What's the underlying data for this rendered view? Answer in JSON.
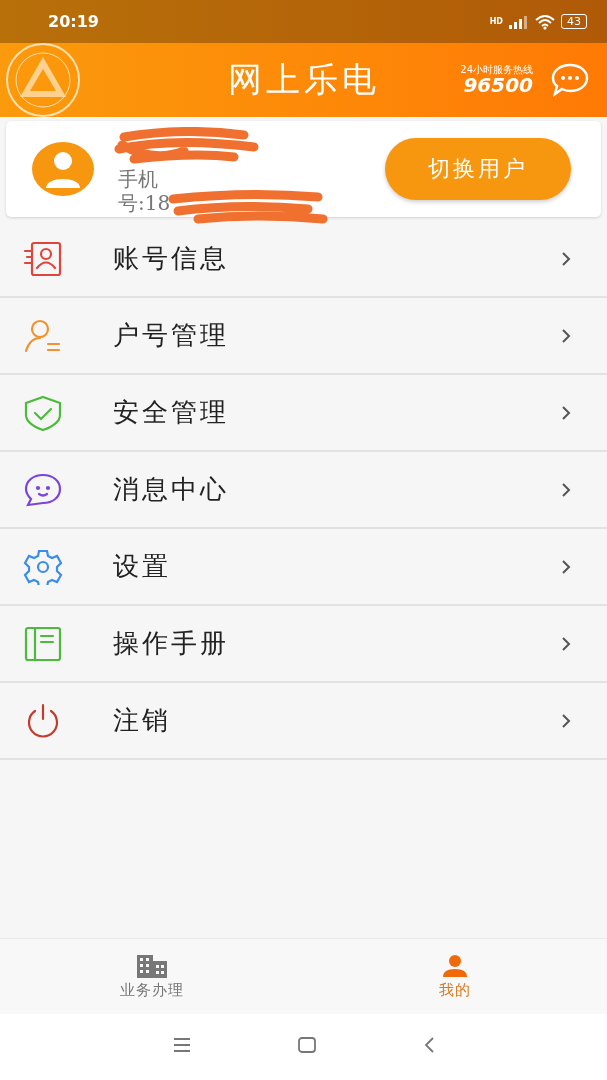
{
  "status_bar": {
    "time": "20:19",
    "network": "HD",
    "battery": "43"
  },
  "header": {
    "title": "网上乐电",
    "hotline_caption": "24小时服务热线",
    "hotline": "96500"
  },
  "user_card": {
    "phone": "手机号:18",
    "switch_button": "切换用户"
  },
  "menu": [
    {
      "label": "账号信息",
      "kind": "account",
      "color": "#e0453c"
    },
    {
      "label": "户号管理",
      "kind": "household",
      "color": "#f0922e"
    },
    {
      "label": "安全管理",
      "kind": "security",
      "color": "#4cbb3c"
    },
    {
      "label": "消息中心",
      "kind": "message",
      "color": "#7a44e0"
    },
    {
      "label": "设置",
      "kind": "settings",
      "color": "#3a8ee8"
    },
    {
      "label": "操作手册",
      "kind": "manual",
      "color": "#4cbb3c"
    },
    {
      "label": "注销",
      "kind": "logout",
      "color": "#c43c30"
    }
  ],
  "bottom_nav": [
    {
      "label": "业务办理",
      "kind": "business",
      "selected": false
    },
    {
      "label": "我的",
      "kind": "mine",
      "selected": true
    }
  ]
}
